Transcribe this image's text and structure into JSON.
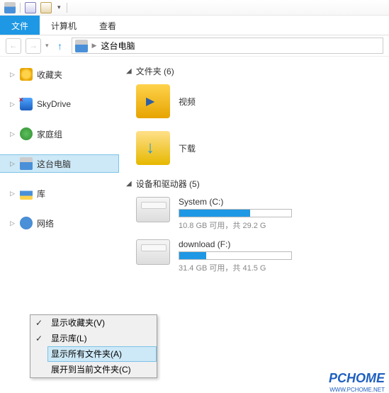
{
  "ribbon": {
    "tabs": [
      "文件",
      "计算机",
      "查看"
    ],
    "active": 0
  },
  "address": {
    "crumb": "这台电脑"
  },
  "sidebar": [
    {
      "label": "收藏夹",
      "icon": "i-star"
    },
    {
      "label": "SkyDrive",
      "icon": "i-sky"
    },
    {
      "label": "家庭组",
      "icon": "i-home"
    },
    {
      "label": "这台电脑",
      "icon": "i-pc",
      "selected": true
    },
    {
      "label": "库",
      "icon": "i-lib"
    },
    {
      "label": "网络",
      "icon": "i-net"
    }
  ],
  "sections": {
    "folders": {
      "title": "文件夹 (6)",
      "items": [
        {
          "label": "视频",
          "icon": "i-folder-vid"
        },
        {
          "label": "下载",
          "icon": "i-folder-dl"
        }
      ]
    },
    "drives": {
      "title": "设备和驱动器 (5)",
      "items": [
        {
          "name": "System (C:)",
          "fill": 63,
          "stat": "10.8 GB 可用，共 29.2 G"
        },
        {
          "name": "download (F:)",
          "fill": 24,
          "stat": "31.4 GB 可用，共 41.5 G"
        }
      ]
    }
  },
  "context_menu": [
    {
      "label": "显示收藏夹(V)",
      "checked": true
    },
    {
      "label": "显示库(L)",
      "checked": true
    },
    {
      "label": "显示所有文件夹(A)",
      "checked": false,
      "highlight": true
    },
    {
      "label": "展开到当前文件夹(C)",
      "checked": false
    }
  ],
  "watermark": {
    "main": "PCHOME",
    "sub": "WWW.PCHOME.NET"
  }
}
